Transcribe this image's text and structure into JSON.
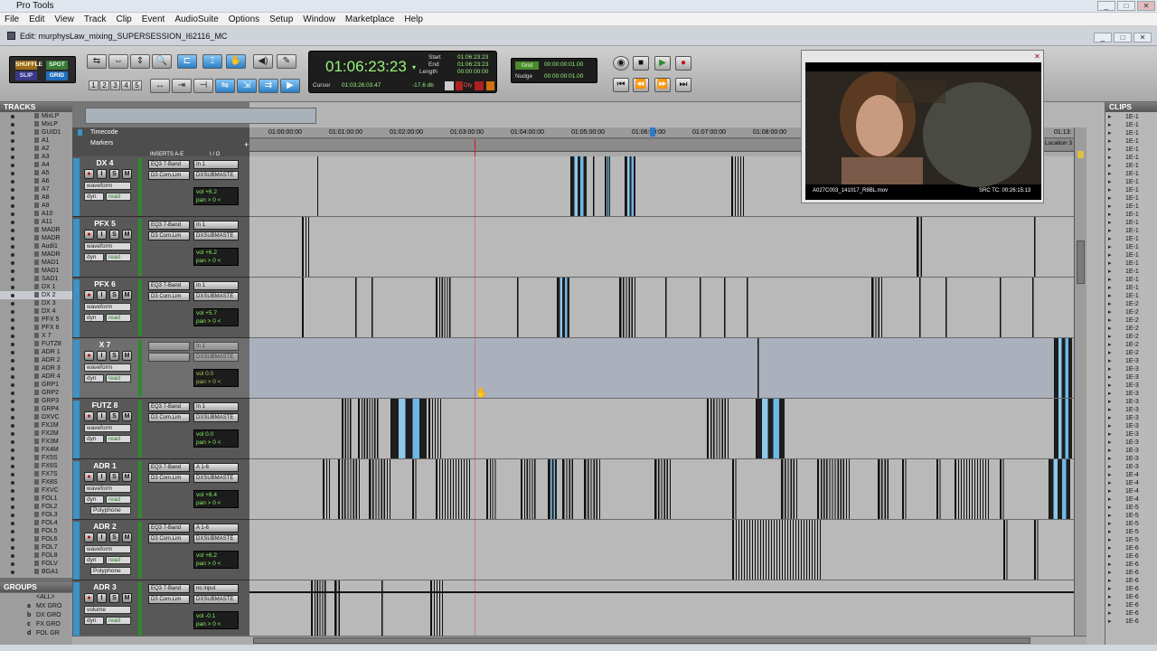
{
  "app": {
    "title": "Pro Tools"
  },
  "window_controls": {
    "minimize": "_",
    "maximize": "□",
    "close": "✕"
  },
  "menu": [
    "File",
    "Edit",
    "View",
    "Track",
    "Clip",
    "Event",
    "AudioSuite",
    "Options",
    "Setup",
    "Window",
    "Marketplace",
    "Help"
  ],
  "edit_window": {
    "title": "Edit: murphysLaw_mixing_SUPERSESSION_I62116_MC"
  },
  "edit_modes": {
    "shuffle": "SHUFFLE",
    "spot": "SPOT",
    "slip": "SLIP",
    "grid": "GRID"
  },
  "tool_numbers": [
    "1",
    "2",
    "3",
    "4",
    "5"
  ],
  "counter": {
    "main": "01:06:23:23",
    "start_label": "Start",
    "start": "01:06:23:23",
    "end_label": "End",
    "end": "01:06:23:23",
    "length_label": "Length",
    "length": "00:00:00:00",
    "cursor_label": "Cursor",
    "cursor": "01:03:26:03.47",
    "level": "-17.6 db",
    "dly_label": "Dly"
  },
  "grid": {
    "label": "Grid",
    "value": "00:00:00:01.00",
    "nudge_label": "Nudge",
    "nudge_value": "00:00:00:01.00"
  },
  "panels": {
    "tracks": "TRACKS",
    "groups": "GROUPS",
    "clips": "CLIPS"
  },
  "track_list": [
    {
      "name": "MixLP",
      "sel": false
    },
    {
      "name": "MxLP",
      "sel": false
    },
    {
      "name": "GUID1",
      "sel": false
    },
    {
      "name": "A1",
      "sel": false
    },
    {
      "name": "A2",
      "sel": false
    },
    {
      "name": "A3",
      "sel": false
    },
    {
      "name": "A4",
      "sel": false
    },
    {
      "name": "A5",
      "sel": false
    },
    {
      "name": "A6",
      "sel": false
    },
    {
      "name": "A7",
      "sel": false
    },
    {
      "name": "A8",
      "sel": false
    },
    {
      "name": "A9",
      "sel": false
    },
    {
      "name": "A10",
      "sel": false
    },
    {
      "name": "A11",
      "sel": false
    },
    {
      "name": "MADR",
      "sel": false
    },
    {
      "name": "MADR",
      "sel": false
    },
    {
      "name": "Audi1",
      "sel": false
    },
    {
      "name": "MADR",
      "sel": false
    },
    {
      "name": "MAD1",
      "sel": false
    },
    {
      "name": "MAD1",
      "sel": false
    },
    {
      "name": "SAD1",
      "sel": false
    },
    {
      "name": "DX 1",
      "sel": false
    },
    {
      "name": "DX 2",
      "sel": true
    },
    {
      "name": "DX 3",
      "sel": false
    },
    {
      "name": "DX 4",
      "sel": false
    },
    {
      "name": "PFX 5",
      "sel": false
    },
    {
      "name": "PFX 6",
      "sel": false
    },
    {
      "name": "X 7",
      "sel": false
    },
    {
      "name": "FUTZ8",
      "sel": false
    },
    {
      "name": "ADR 1",
      "sel": false
    },
    {
      "name": "ADR 2",
      "sel": false
    },
    {
      "name": "ADR 3",
      "sel": false
    },
    {
      "name": "ADR 4",
      "sel": false
    },
    {
      "name": "GRP1",
      "sel": false
    },
    {
      "name": "GRP2",
      "sel": false
    },
    {
      "name": "GRP3",
      "sel": false
    },
    {
      "name": "GRP4",
      "sel": false
    },
    {
      "name": "DXVC",
      "sel": false
    },
    {
      "name": "FX1M",
      "sel": false
    },
    {
      "name": "FX2M",
      "sel": false
    },
    {
      "name": "FX3M",
      "sel": false
    },
    {
      "name": "FX4M",
      "sel": false
    },
    {
      "name": "FX5S",
      "sel": false
    },
    {
      "name": "FX6S",
      "sel": false
    },
    {
      "name": "FX7S",
      "sel": false
    },
    {
      "name": "FX8S",
      "sel": false
    },
    {
      "name": "FXVC",
      "sel": false
    },
    {
      "name": "FOL1",
      "sel": false
    },
    {
      "name": "FOL2",
      "sel": false
    },
    {
      "name": "FOL3",
      "sel": false
    },
    {
      "name": "FOL4",
      "sel": false
    },
    {
      "name": "FOL5",
      "sel": false
    },
    {
      "name": "FOL6",
      "sel": false
    },
    {
      "name": "FOL7",
      "sel": false
    },
    {
      "name": "FOL8",
      "sel": false
    },
    {
      "name": "FOLV",
      "sel": false
    },
    {
      "name": "BGA1",
      "sel": false
    }
  ],
  "groups_list": [
    {
      "letter": "",
      "name": "<ALL>"
    },
    {
      "letter": "a",
      "name": "MX GRO"
    },
    {
      "letter": "b",
      "name": "DX GRO"
    },
    {
      "letter": "c",
      "name": "FX GRO"
    },
    {
      "letter": "d",
      "name": "FOL GR"
    }
  ],
  "column_headers": {
    "inserts": "INSERTS A-E",
    "io": "I / O",
    "timecode": "Timecode",
    "markers": "Markers"
  },
  "ruler_ticks": [
    "01:00:00:00",
    "01:01:00:00",
    "01:02:00:00",
    "01:03:00:00",
    "01:04:00:00",
    "01:05:00:00",
    "01:06:00:00",
    "01:07:00:00",
    "01:08:00:00",
    "01:13:"
  ],
  "location_marker": "Location 3",
  "tracks": [
    {
      "name": "DX 4",
      "insert1": "EQ3 7-Band",
      "insert2": "D3 Com.Lim",
      "io_in": "In 1",
      "io_out": "DXSUBMASTE",
      "view": "waveform",
      "dyn": "dyn",
      "auto": "read",
      "vol": "vol +6.2",
      "pan": "pan > 0 <",
      "inactive": false
    },
    {
      "name": "PFX 5",
      "insert1": "EQ3 7-Band",
      "insert2": "D3 Com.Lim",
      "io_in": "In 1",
      "io_out": "DXSUBMASTE",
      "view": "waveform",
      "dyn": "dyn",
      "auto": "read",
      "vol": "vol +6.2",
      "pan": "pan > 0 <",
      "inactive": false
    },
    {
      "name": "PFX 6",
      "insert1": "EQ3 7-Band",
      "insert2": "D3 Com.Lim",
      "io_in": "In 1",
      "io_out": "DXSUBMASTE",
      "view": "waveform",
      "dyn": "dyn",
      "auto": "read",
      "vol": "vol +5.7",
      "pan": "pan > 0 <",
      "inactive": false
    },
    {
      "name": "X 7",
      "insert1": "",
      "insert2": "",
      "io_in": "In 1",
      "io_out": "DXSUBMASTE",
      "view": "waveform",
      "dyn": "dyn",
      "auto": "read",
      "vol": "vol 0.0",
      "pan": "pan > 0 <",
      "inactive": true
    },
    {
      "name": "FUTZ 8",
      "insert1": "EQ3 7-Band",
      "insert2": "D3 Com.Lim",
      "io_in": "In 1",
      "io_out": "DXSUBMASTE",
      "view": "waveform",
      "dyn": "dyn",
      "auto": "read",
      "vol": "vol 0.0",
      "pan": "pan > 0 <",
      "inactive": false
    },
    {
      "name": "ADR 1",
      "insert1": "EQ3 7-Band",
      "insert2": "D3 Com.Lim",
      "io_in": "A 1-6",
      "io_out": "DXSUBMASTE",
      "view": "waveform",
      "dyn": "dyn",
      "auto": "read",
      "vol": "vol +8.4",
      "pan": "pan > 0 <",
      "extra": "Polyphone",
      "inactive": false
    },
    {
      "name": "ADR 2",
      "insert1": "EQ3 7-Band",
      "insert2": "D3 Com.Lim",
      "io_in": "A 1-6",
      "io_out": "DXSUBMASTE",
      "view": "waveform",
      "dyn": "dyn",
      "auto": "read",
      "vol": "vol +6.2",
      "pan": "pan > 0 <",
      "extra": "Polyphone",
      "inactive": false
    },
    {
      "name": "ADR 3",
      "insert1": "EQ3 7-Band",
      "insert2": "D3 Com.Lim",
      "io_in": "no input",
      "io_out": "DXSUBMASTE",
      "view": "volume",
      "dyn": "dyn",
      "auto": "read",
      "vol": "vol -0.1",
      "pan": "pan > 0 <",
      "inactive": false
    }
  ],
  "video": {
    "filename": "A027C003_141017_R8BL.mov",
    "src_tc": "SRC TC: 00:26:15:13"
  },
  "clips_list": [
    "1E-1",
    "1E-1",
    "1E-1",
    "1E-1",
    "1E-1",
    "1E-1",
    "1E-1",
    "1E-1",
    "1E-1",
    "1E-1",
    "1E-1",
    "1E-1",
    "1E-1",
    "1E-1",
    "1E-1",
    "1E-1",
    "1E-1",
    "1E-1",
    "1E-1",
    "1E-1",
    "1E-1",
    "1E-1",
    "1E-1",
    "1E-2",
    "1E-2",
    "1E-2",
    "1E-2",
    "1E-2",
    "1E-2",
    "1E-2",
    "1E-3",
    "1E-3",
    "1E-3",
    "1E-3",
    "1E-3",
    "1E-3",
    "1E-3",
    "1E-3",
    "1E-3",
    "1E-3",
    "1E-3",
    "1E-3",
    "1E-3",
    "1E-3",
    "1E-4",
    "1E-4",
    "1E-4",
    "1E-4",
    "1E-5",
    "1E-5",
    "1E-5",
    "1E-5",
    "1E-5",
    "1E-6",
    "1E-6",
    "1E-6",
    "1E-6",
    "1E-6",
    "1E-6",
    "1E-6",
    "1E-6",
    "1E-6",
    "1E-6"
  ],
  "colors": {
    "accent": "#3b93c8",
    "counter_text": "#9af37c",
    "playhead": "#d22020"
  }
}
